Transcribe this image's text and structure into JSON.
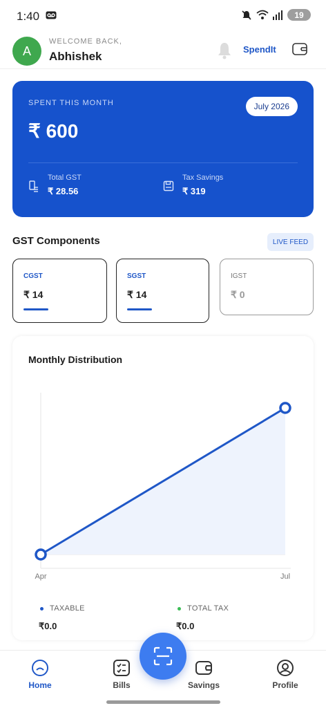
{
  "status_bar": {
    "time": "1:40",
    "battery": "19"
  },
  "header": {
    "avatar_initial": "A",
    "welcome": "WELCOME BACK,",
    "username": "Abhishek",
    "brand": "SpendIt"
  },
  "summary": {
    "label": "SPENT THIS MONTH",
    "month": "July 2026",
    "amount": "₹ 600",
    "total_gst_label": "Total GST",
    "total_gst_value": "₹ 28.56",
    "tax_savings_label": "Tax Savings",
    "tax_savings_value": "₹ 319"
  },
  "gst": {
    "title": "GST Components",
    "badge": "LIVE FEED",
    "components": [
      {
        "name": "CGST",
        "value": "₹ 14"
      },
      {
        "name": "SGST",
        "value": "₹ 14"
      },
      {
        "name": "IGST",
        "value": "₹ 0"
      }
    ]
  },
  "chart": {
    "title": "Monthly Distribution",
    "legend": [
      {
        "label": "TAXABLE",
        "value": "₹0.0",
        "color": "#1f57c7"
      },
      {
        "label": "TOTAL TAX",
        "value": "₹0.0",
        "color": "#3bbd55"
      }
    ]
  },
  "chart_data": {
    "type": "area",
    "x": [
      "Apr",
      "Jul"
    ],
    "series": [
      {
        "values": [
          0,
          600
        ]
      }
    ],
    "ylim": [
      0,
      600
    ],
    "grid": false,
    "color": "#1f57c7"
  },
  "nav": {
    "items": [
      {
        "label": "Home"
      },
      {
        "label": "Bills"
      },
      {
        "label": "Savings"
      },
      {
        "label": "Profile"
      }
    ]
  },
  "colors": {
    "primary": "#1652cc",
    "accent": "#1f57c7",
    "fab": "#3d7cf0"
  }
}
